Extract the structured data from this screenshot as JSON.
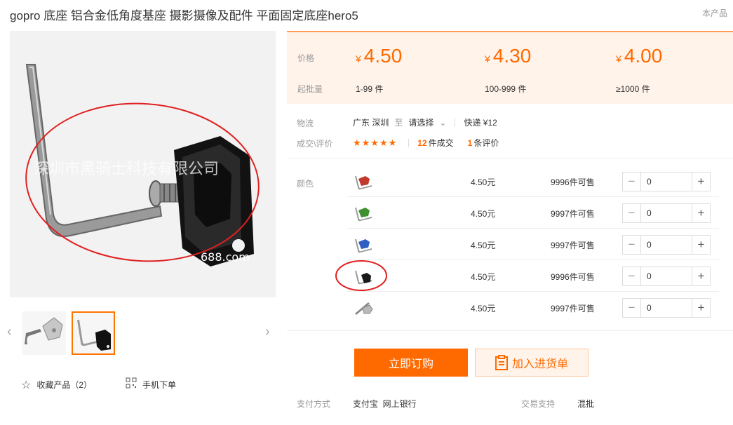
{
  "title": "gopro 底座 铝合金低角度基座 摄影摄像及配件 平面固定底座hero5",
  "corner_link": "本产品",
  "gallery": {
    "watermark": "深圳市黑骑士科技有限公司",
    "watermark_partial": "688.com"
  },
  "left_actions": {
    "favorite": "收藏产品（2）",
    "mobile": "手机下单"
  },
  "price_box": {
    "price_label": "价格",
    "moq_label": "起批量",
    "currency": "¥",
    "tiers": [
      {
        "price": "4.50",
        "range": "1-99 件"
      },
      {
        "price": "4.30",
        "range": "100-999 件"
      },
      {
        "price": "4.00",
        "range": "≥1000 件"
      }
    ]
  },
  "logistics": {
    "label": "物流",
    "from": "广东 深圳",
    "to_word": "至",
    "select": "请选择",
    "express": "快递 ¥12"
  },
  "deal": {
    "label": "成交\\评价",
    "stars": "★★★★★",
    "deals_count": "12",
    "deals_suffix": "件成交",
    "reviews_count": "1",
    "reviews_suffix": "条评价"
  },
  "color_label": "颜色",
  "variants": [
    {
      "color": "#c0392b",
      "price": "4.50元",
      "stock": "9996件可售",
      "qty": "0"
    },
    {
      "color": "#3f8f2e",
      "price": "4.50元",
      "stock": "9997件可售",
      "qty": "0"
    },
    {
      "color": "#2f5fc4",
      "price": "4.50元",
      "stock": "9997件可售",
      "qty": "0"
    },
    {
      "color": "#1a1a1a",
      "price": "4.50元",
      "stock": "9996件可售",
      "qty": "0"
    },
    {
      "color": "#b9b9b9",
      "price": "4.50元",
      "stock": "9997件可售",
      "qty": "0"
    }
  ],
  "buttons": {
    "buy": "立即订购",
    "cart": "加入进货单"
  },
  "payment": {
    "label": "支付方式",
    "methods": "支付宝  网上银行",
    "trade_label": "交易支持",
    "trade_value": "混批"
  },
  "accent": "#ff6a00",
  "annotation_color": "#e02020"
}
